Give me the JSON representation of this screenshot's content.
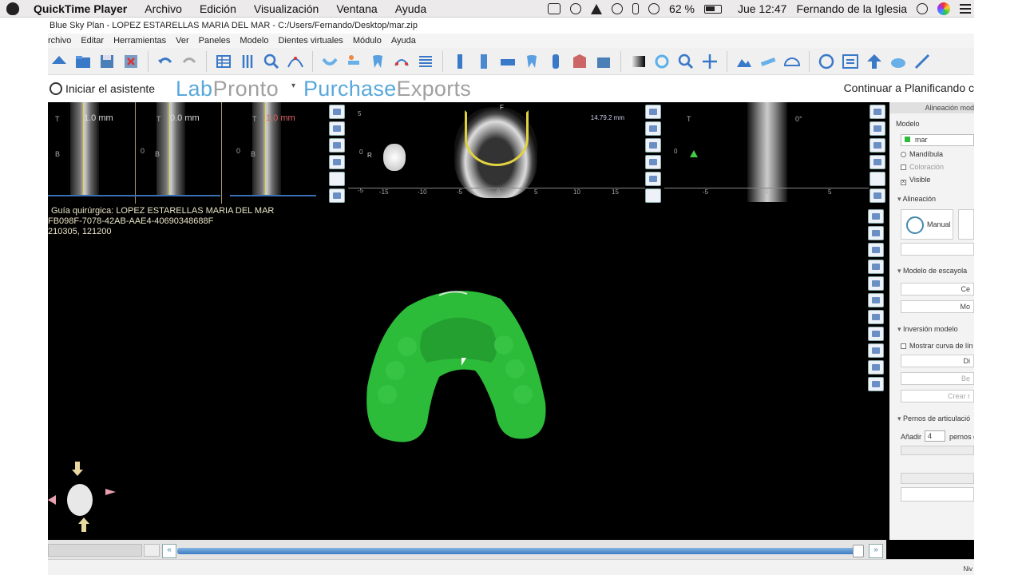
{
  "mac_menubar": {
    "app_name": "QuickTime Player",
    "items": [
      "Archivo",
      "Edición",
      "Visualización",
      "Ventana",
      "Ayuda"
    ],
    "battery": "62 %",
    "clock": "Jue 12:47",
    "user": "Fernando de la Iglesia"
  },
  "window": {
    "title": "Blue Sky Plan - LOPEZ ESTARELLAS MARIA DEL MAR - C:/Users/Fernando/Desktop/mar.zip"
  },
  "app_menu": {
    "items": [
      "rchivo",
      "Editar",
      "Herramientas",
      "Ver",
      "Paneles",
      "Modelo",
      "Dientes virtuales",
      "Módulo",
      "Ayuda"
    ]
  },
  "wizard": {
    "start_label": "Iniciar el asistente",
    "logo1_a": "Lab",
    "logo1_b": "Pronto",
    "logo2_a": "Purchase",
    "logo2_b": "Exports",
    "continue_label": "Continuar a Planificando c"
  },
  "slices": [
    {
      "mm": "1.0 mm",
      "t": "T",
      "b": "B",
      "zero": ""
    },
    {
      "mm": "0.0 mm",
      "t": "T",
      "b": "B",
      "zero": "0"
    },
    {
      "mm": "1.0 mm",
      "t": "T",
      "b": "B",
      "zero": "0"
    }
  ],
  "axial": {
    "top_label": "F",
    "left_label": "R",
    "measure": "14.79.2 mm",
    "y_ticks": [
      "5",
      "0",
      "-5"
    ],
    "x_ticks": [
      "-15",
      "-10",
      "-5",
      "0",
      "5",
      "10",
      "15"
    ]
  },
  "sagittal": {
    "t_label": "T",
    "angle": "0°",
    "zero": "0",
    "ticks": [
      "-5",
      "0",
      "5"
    ]
  },
  "view3d": {
    "line1": "Guía quirúrgica: LOPEZ ESTARELLAS MARIA DEL MAR",
    "line2": "FB098F-7078-42AB-AAE4-40690348688F",
    "line3": "210305, 121200"
  },
  "panel": {
    "title": "Alineación mod",
    "modelo_label": "Modelo",
    "model_name": "mar",
    "mandibula": "Mandíbula",
    "coloracion": "Coloración",
    "visible": "Visible",
    "alineacion": "Alineación",
    "manual": "Manual",
    "escayola": "Modelo de escayola",
    "btn_ce": "Ce",
    "btn_mo": "Mo",
    "inversion": "Inversión modelo",
    "mostrar_curva": "Mostrar curva de lín",
    "btn_di": "Di",
    "btn_be": "Be",
    "btn_crear": "Crear r",
    "pernos": "Pernos de articulació",
    "anadir": "Añadir",
    "anadir_val": "4",
    "pernos_suffix": "pernos c"
  },
  "status": {
    "right_text": "Niv"
  },
  "colors": {
    "model_green": "#2dbb3a",
    "accent_blue": "#58a8dd",
    "slice_yellow": "#e6d54a"
  }
}
